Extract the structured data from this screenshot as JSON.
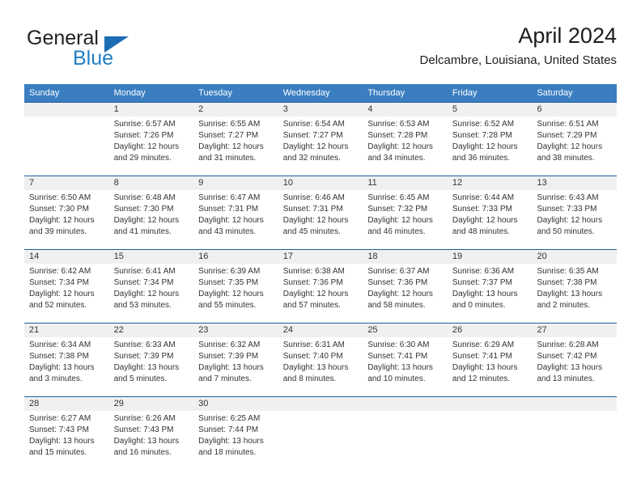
{
  "brand": {
    "name_part1": "General",
    "name_part2": "Blue",
    "accent_color": "#1f7ec4",
    "triangle_icon": "triangle-icon"
  },
  "header": {
    "title": "April 2024",
    "subtitle": "Delcambre, Louisiana, United States"
  },
  "calendar": {
    "header_bg": "#3a7ec1",
    "daynum_bg": "#f0f0f0",
    "separator_color": "#1f5fa0",
    "weekdays": [
      "Sunday",
      "Monday",
      "Tuesday",
      "Wednesday",
      "Thursday",
      "Friday",
      "Saturday"
    ],
    "weeks": [
      {
        "days": [
          {
            "num": "",
            "sunrise": "",
            "sunset": "",
            "daylight1": "",
            "daylight2": ""
          },
          {
            "num": "1",
            "sunrise": "Sunrise: 6:57 AM",
            "sunset": "Sunset: 7:26 PM",
            "daylight1": "Daylight: 12 hours",
            "daylight2": "and 29 minutes."
          },
          {
            "num": "2",
            "sunrise": "Sunrise: 6:55 AM",
            "sunset": "Sunset: 7:27 PM",
            "daylight1": "Daylight: 12 hours",
            "daylight2": "and 31 minutes."
          },
          {
            "num": "3",
            "sunrise": "Sunrise: 6:54 AM",
            "sunset": "Sunset: 7:27 PM",
            "daylight1": "Daylight: 12 hours",
            "daylight2": "and 32 minutes."
          },
          {
            "num": "4",
            "sunrise": "Sunrise: 6:53 AM",
            "sunset": "Sunset: 7:28 PM",
            "daylight1": "Daylight: 12 hours",
            "daylight2": "and 34 minutes."
          },
          {
            "num": "5",
            "sunrise": "Sunrise: 6:52 AM",
            "sunset": "Sunset: 7:28 PM",
            "daylight1": "Daylight: 12 hours",
            "daylight2": "and 36 minutes."
          },
          {
            "num": "6",
            "sunrise": "Sunrise: 6:51 AM",
            "sunset": "Sunset: 7:29 PM",
            "daylight1": "Daylight: 12 hours",
            "daylight2": "and 38 minutes."
          }
        ]
      },
      {
        "days": [
          {
            "num": "7",
            "sunrise": "Sunrise: 6:50 AM",
            "sunset": "Sunset: 7:30 PM",
            "daylight1": "Daylight: 12 hours",
            "daylight2": "and 39 minutes."
          },
          {
            "num": "8",
            "sunrise": "Sunrise: 6:48 AM",
            "sunset": "Sunset: 7:30 PM",
            "daylight1": "Daylight: 12 hours",
            "daylight2": "and 41 minutes."
          },
          {
            "num": "9",
            "sunrise": "Sunrise: 6:47 AM",
            "sunset": "Sunset: 7:31 PM",
            "daylight1": "Daylight: 12 hours",
            "daylight2": "and 43 minutes."
          },
          {
            "num": "10",
            "sunrise": "Sunrise: 6:46 AM",
            "sunset": "Sunset: 7:31 PM",
            "daylight1": "Daylight: 12 hours",
            "daylight2": "and 45 minutes."
          },
          {
            "num": "11",
            "sunrise": "Sunrise: 6:45 AM",
            "sunset": "Sunset: 7:32 PM",
            "daylight1": "Daylight: 12 hours",
            "daylight2": "and 46 minutes."
          },
          {
            "num": "12",
            "sunrise": "Sunrise: 6:44 AM",
            "sunset": "Sunset: 7:33 PM",
            "daylight1": "Daylight: 12 hours",
            "daylight2": "and 48 minutes."
          },
          {
            "num": "13",
            "sunrise": "Sunrise: 6:43 AM",
            "sunset": "Sunset: 7:33 PM",
            "daylight1": "Daylight: 12 hours",
            "daylight2": "and 50 minutes."
          }
        ]
      },
      {
        "days": [
          {
            "num": "14",
            "sunrise": "Sunrise: 6:42 AM",
            "sunset": "Sunset: 7:34 PM",
            "daylight1": "Daylight: 12 hours",
            "daylight2": "and 52 minutes."
          },
          {
            "num": "15",
            "sunrise": "Sunrise: 6:41 AM",
            "sunset": "Sunset: 7:34 PM",
            "daylight1": "Daylight: 12 hours",
            "daylight2": "and 53 minutes."
          },
          {
            "num": "16",
            "sunrise": "Sunrise: 6:39 AM",
            "sunset": "Sunset: 7:35 PM",
            "daylight1": "Daylight: 12 hours",
            "daylight2": "and 55 minutes."
          },
          {
            "num": "17",
            "sunrise": "Sunrise: 6:38 AM",
            "sunset": "Sunset: 7:36 PM",
            "daylight1": "Daylight: 12 hours",
            "daylight2": "and 57 minutes."
          },
          {
            "num": "18",
            "sunrise": "Sunrise: 6:37 AM",
            "sunset": "Sunset: 7:36 PM",
            "daylight1": "Daylight: 12 hours",
            "daylight2": "and 58 minutes."
          },
          {
            "num": "19",
            "sunrise": "Sunrise: 6:36 AM",
            "sunset": "Sunset: 7:37 PM",
            "daylight1": "Daylight: 13 hours",
            "daylight2": "and 0 minutes."
          },
          {
            "num": "20",
            "sunrise": "Sunrise: 6:35 AM",
            "sunset": "Sunset: 7:38 PM",
            "daylight1": "Daylight: 13 hours",
            "daylight2": "and 2 minutes."
          }
        ]
      },
      {
        "days": [
          {
            "num": "21",
            "sunrise": "Sunrise: 6:34 AM",
            "sunset": "Sunset: 7:38 PM",
            "daylight1": "Daylight: 13 hours",
            "daylight2": "and 3 minutes."
          },
          {
            "num": "22",
            "sunrise": "Sunrise: 6:33 AM",
            "sunset": "Sunset: 7:39 PM",
            "daylight1": "Daylight: 13 hours",
            "daylight2": "and 5 minutes."
          },
          {
            "num": "23",
            "sunrise": "Sunrise: 6:32 AM",
            "sunset": "Sunset: 7:39 PM",
            "daylight1": "Daylight: 13 hours",
            "daylight2": "and 7 minutes."
          },
          {
            "num": "24",
            "sunrise": "Sunrise: 6:31 AM",
            "sunset": "Sunset: 7:40 PM",
            "daylight1": "Daylight: 13 hours",
            "daylight2": "and 8 minutes."
          },
          {
            "num": "25",
            "sunrise": "Sunrise: 6:30 AM",
            "sunset": "Sunset: 7:41 PM",
            "daylight1": "Daylight: 13 hours",
            "daylight2": "and 10 minutes."
          },
          {
            "num": "26",
            "sunrise": "Sunrise: 6:29 AM",
            "sunset": "Sunset: 7:41 PM",
            "daylight1": "Daylight: 13 hours",
            "daylight2": "and 12 minutes."
          },
          {
            "num": "27",
            "sunrise": "Sunrise: 6:28 AM",
            "sunset": "Sunset: 7:42 PM",
            "daylight1": "Daylight: 13 hours",
            "daylight2": "and 13 minutes."
          }
        ]
      },
      {
        "days": [
          {
            "num": "28",
            "sunrise": "Sunrise: 6:27 AM",
            "sunset": "Sunset: 7:43 PM",
            "daylight1": "Daylight: 13 hours",
            "daylight2": "and 15 minutes."
          },
          {
            "num": "29",
            "sunrise": "Sunrise: 6:26 AM",
            "sunset": "Sunset: 7:43 PM",
            "daylight1": "Daylight: 13 hours",
            "daylight2": "and 16 minutes."
          },
          {
            "num": "30",
            "sunrise": "Sunrise: 6:25 AM",
            "sunset": "Sunset: 7:44 PM",
            "daylight1": "Daylight: 13 hours",
            "daylight2": "and 18 minutes."
          },
          {
            "num": "",
            "sunrise": "",
            "sunset": "",
            "daylight1": "",
            "daylight2": ""
          },
          {
            "num": "",
            "sunrise": "",
            "sunset": "",
            "daylight1": "",
            "daylight2": ""
          },
          {
            "num": "",
            "sunrise": "",
            "sunset": "",
            "daylight1": "",
            "daylight2": ""
          },
          {
            "num": "",
            "sunrise": "",
            "sunset": "",
            "daylight1": "",
            "daylight2": ""
          }
        ]
      }
    ]
  }
}
